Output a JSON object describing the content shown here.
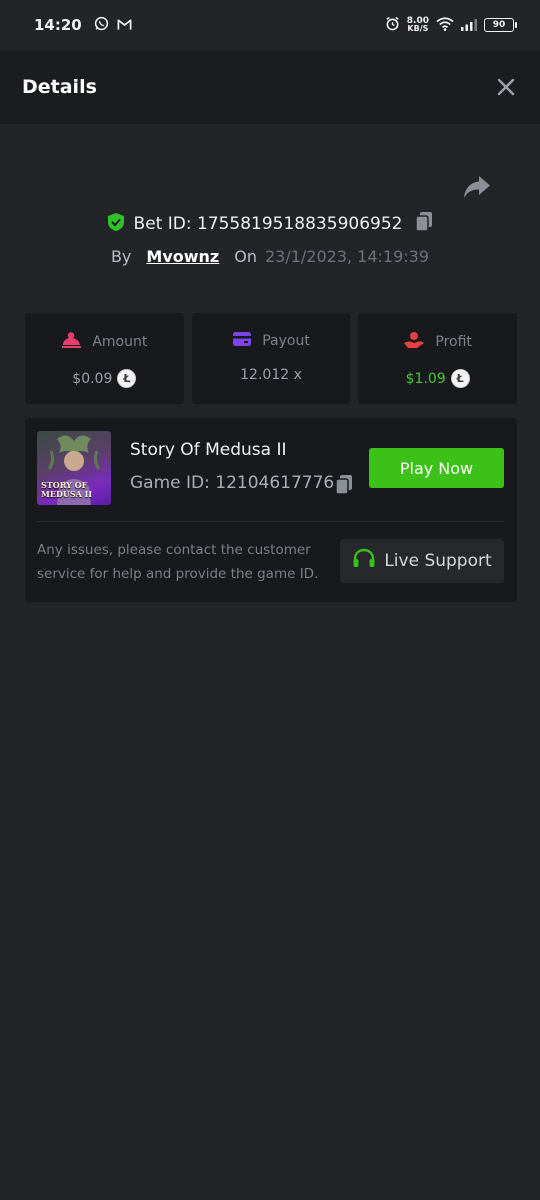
{
  "status_bar": {
    "time": "14:20",
    "speed_value": "8.00",
    "speed_unit": "KB/S",
    "battery": "90",
    "icons": [
      "whatsapp-icon",
      "gmail-icon",
      "alarm-icon",
      "wifi-icon",
      "signal-icon",
      "battery-icon"
    ]
  },
  "header": {
    "title": "Details"
  },
  "bet": {
    "id_label": "Bet ID: 1755819518835906952",
    "by_label": "By",
    "username": "Mvownz",
    "on_label": "On",
    "datetime": "23/1/2023, 14:19:39"
  },
  "stats": {
    "amount": {
      "label": "Amount",
      "value": "$0.09",
      "color": "#e83d6d"
    },
    "payout": {
      "label": "Payout",
      "value": "12.012 x",
      "color": "#7b45e8"
    },
    "profit": {
      "label": "Profit",
      "value": "$1.09",
      "color": "#e84040"
    },
    "currency_icon": "litecoin-icon"
  },
  "game": {
    "thumbnail_text": "STORY OF MEDUSA II",
    "name": "Story Of Medusa II",
    "id_label": "Game ID: 12104617776",
    "play_label": "Play Now"
  },
  "support": {
    "message": "Any issues, please contact the customer service for help and provide the game ID.",
    "button_label": "Live Support"
  },
  "colors": {
    "accent_green": "#3bc117",
    "background": "#232428",
    "card": "#18191c"
  }
}
